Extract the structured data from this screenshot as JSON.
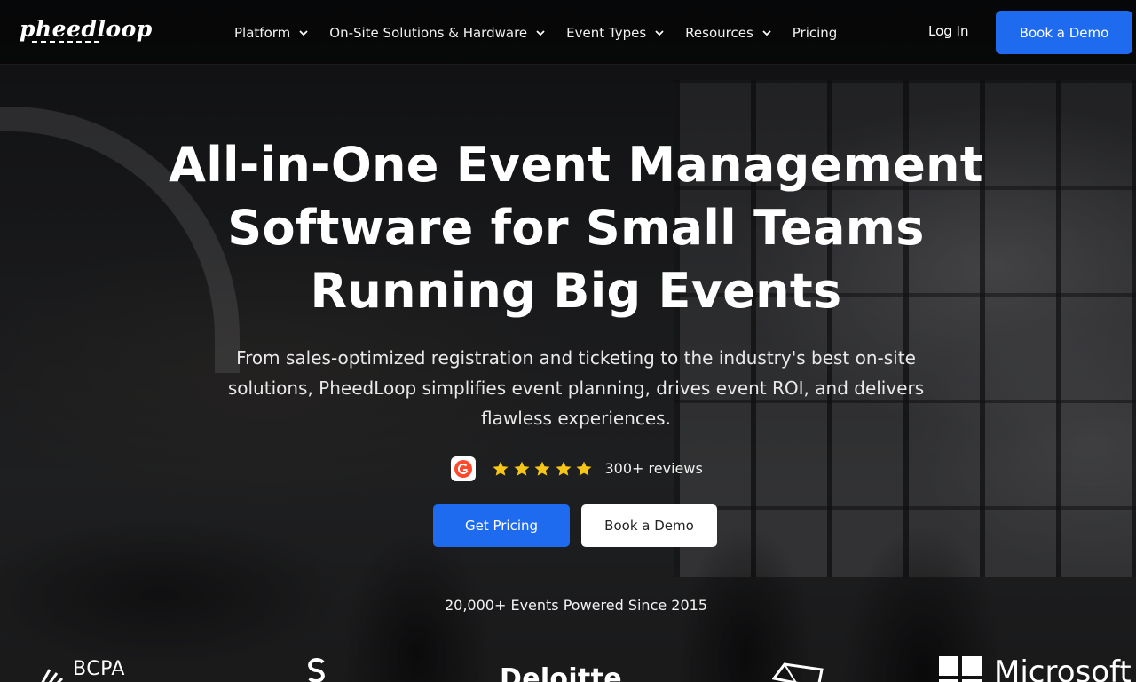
{
  "header": {
    "logo_text": "pheedloop",
    "nav": [
      {
        "label": "Platform",
        "has_dropdown": true
      },
      {
        "label": "On-Site Solutions & Hardware",
        "has_dropdown": true
      },
      {
        "label": "Event Types",
        "has_dropdown": true
      },
      {
        "label": "Resources",
        "has_dropdown": true
      },
      {
        "label": "Pricing",
        "has_dropdown": false
      }
    ],
    "login_label": "Log In",
    "demo_label": "Book a Demo"
  },
  "hero": {
    "title_line1": "All-in-One Event Management",
    "title_line2": "Software for Small Teams",
    "title_line3": "Running Big Events",
    "subtitle_line1": "From sales-optimized registration and ticketing to the industry's best on-site",
    "subtitle_line2": "solutions, PheedLoop simplifies event planning, drives event ROI, and delivers",
    "subtitle_line3": "flawless experiences.",
    "rating_stars": 5,
    "reviews_text": "300+ reviews",
    "pricing_button": "Get Pricing",
    "demo_button": "Book a Demo",
    "powered_text": "20,000+ Events Powered Since 2015"
  },
  "logos": {
    "bcpa": "BCPA",
    "deloitte": "Deloitte",
    "microsoft": "Microsoft"
  },
  "colors": {
    "primary": "#1f6bf0",
    "star": "#f5c518",
    "g2_red": "#ff492c"
  }
}
